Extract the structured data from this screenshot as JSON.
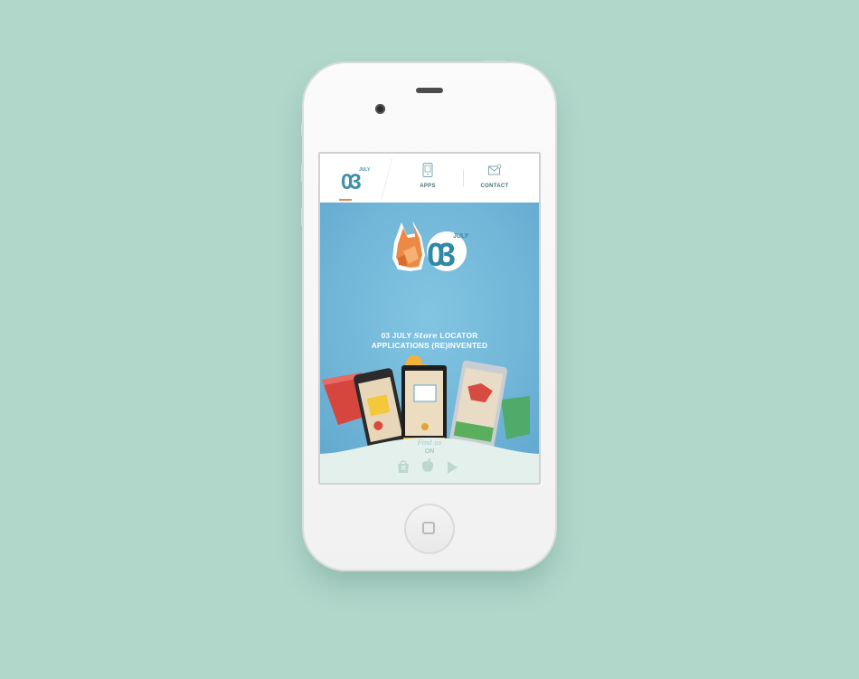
{
  "nav": {
    "logo_text": "03",
    "logo_sub": "JULY",
    "apps_label": "APPS",
    "contact_label": "CONTACT"
  },
  "hero": {
    "logo_text": "03",
    "logo_sub": "JULY",
    "line1_a": "03 JULY",
    "line1_store": "Store",
    "line1_b": "LOCATOR",
    "line2": "APPLICATIONS (RE)INVENTED"
  },
  "footer": {
    "find_us_line1": "Find us",
    "find_us_line2": "ON",
    "stores": [
      "windows-store-icon",
      "apple-store-icon",
      "google-play-icon"
    ]
  },
  "colors": {
    "background": "#b1d7cb",
    "hero": "#72b6d8",
    "accent": "#e98a4d",
    "brand": "#3f91a8"
  }
}
